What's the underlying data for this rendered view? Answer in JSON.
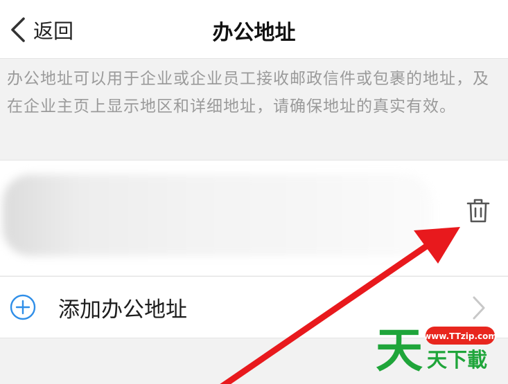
{
  "nav": {
    "back_label": "返回",
    "title": "办公地址"
  },
  "description": "办公地址可以用于企业或企业员工接收邮政信件或包裹的地址，及在企业主页上显示地区和详细地址，请确保地址的真实有效。",
  "address_row": {
    "delete_icon": "trash-icon"
  },
  "add_row": {
    "label": "添加办公地址",
    "icon": "plus-circle-icon"
  },
  "watermark": {
    "url": "www.TTzip.com",
    "brand_char": "天",
    "brand_text": "天下載"
  },
  "colors": {
    "accent": "#2f8ee8",
    "annotation_arrow": "#e8191d",
    "watermark_green": "#1fa53a",
    "watermark_badge": "#e8261e"
  }
}
